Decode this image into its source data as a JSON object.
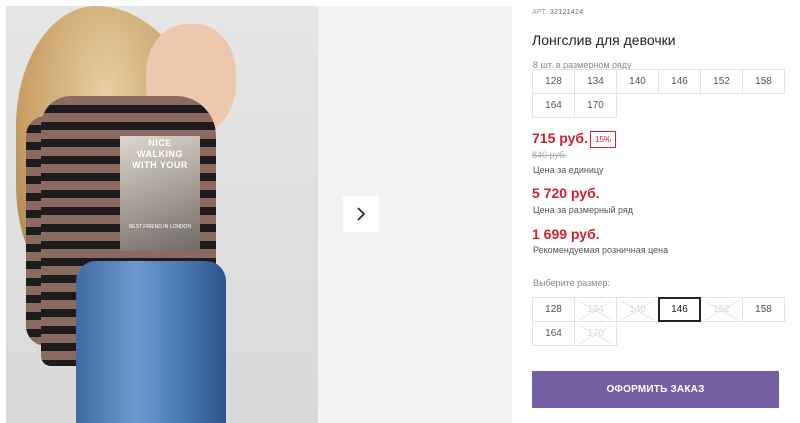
{
  "product": {
    "article_label": "АРТ.",
    "article_number": "32121424",
    "title": "Лонгслив для девочки"
  },
  "gallery": {
    "print_text": "NICE\nWALKING\nWITH YOUR",
    "print_small": "BEST FRIEND IN LONDON",
    "next_icon": "chevron-right-icon"
  },
  "size_run": {
    "note": "8 шт. в размерном ряду",
    "sizes": [
      "128",
      "134",
      "140",
      "146",
      "152",
      "158",
      "164",
      "170"
    ]
  },
  "pricing": {
    "unit_price": "715 руб.",
    "discount": "15%",
    "old_price": "840 руб.",
    "unit_price_note": "Цена за единицу",
    "run_price": "5 720 руб.",
    "run_price_note": "Цена за размерный ряд",
    "retail_price": "1 699 руб.",
    "retail_price_note": "Рекомендуемая розничная цена"
  },
  "size_select": {
    "label": "Выберите размер:",
    "options": [
      {
        "label": "128",
        "state": "available"
      },
      {
        "label": "134",
        "state": "disabled"
      },
      {
        "label": "140",
        "state": "disabled"
      },
      {
        "label": "146",
        "state": "selected"
      },
      {
        "label": "152",
        "state": "disabled"
      },
      {
        "label": "158",
        "state": "available"
      },
      {
        "label": "164",
        "state": "available"
      },
      {
        "label": "170",
        "state": "disabled"
      }
    ]
  },
  "order_button": "ОФОРМИТЬ ЗАКАЗ",
  "colors": {
    "accent": "#755fa3",
    "price_red": "#d1202f"
  }
}
